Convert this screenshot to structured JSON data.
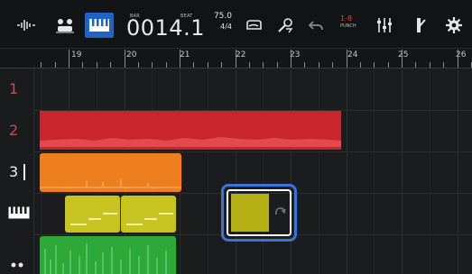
{
  "toolbar": {
    "icons": [
      "waveform-icon",
      "drum-icon",
      "piano-icon",
      "loop-icon",
      "effects-icon",
      "undo-icon",
      "punch-icon",
      "mixer-icon",
      "metronome-icon",
      "settings-icon"
    ],
    "counter": {
      "bar_label": "BAR",
      "beat_label": "BEAT",
      "value": "0014.1"
    },
    "tempo": {
      "bpm": "75.0",
      "time_signature": "4/4"
    },
    "punch": {
      "range": "1-8",
      "label": "PUNCH"
    }
  },
  "ruler": {
    "bars": [
      "19",
      "20",
      "21",
      "22",
      "23",
      "24",
      "25",
      "26"
    ]
  },
  "tracks": [
    {
      "number": "1",
      "color": "#e04545"
    },
    {
      "number": "2",
      "color": "#e04545",
      "clip_color": "#c8262c"
    },
    {
      "number": "3",
      "color": "#f0f0f0",
      "clip_color": "#ee7f1e"
    },
    {
      "number": "",
      "icon": "piano-icon",
      "clip_color": "#c7c41f"
    },
    {
      "number": "",
      "icon": "drum-icon",
      "clip_color": "#2fa83a"
    }
  ],
  "selection": {
    "clip_color": "#b5b015",
    "selector_color": "#3a74d6"
  }
}
